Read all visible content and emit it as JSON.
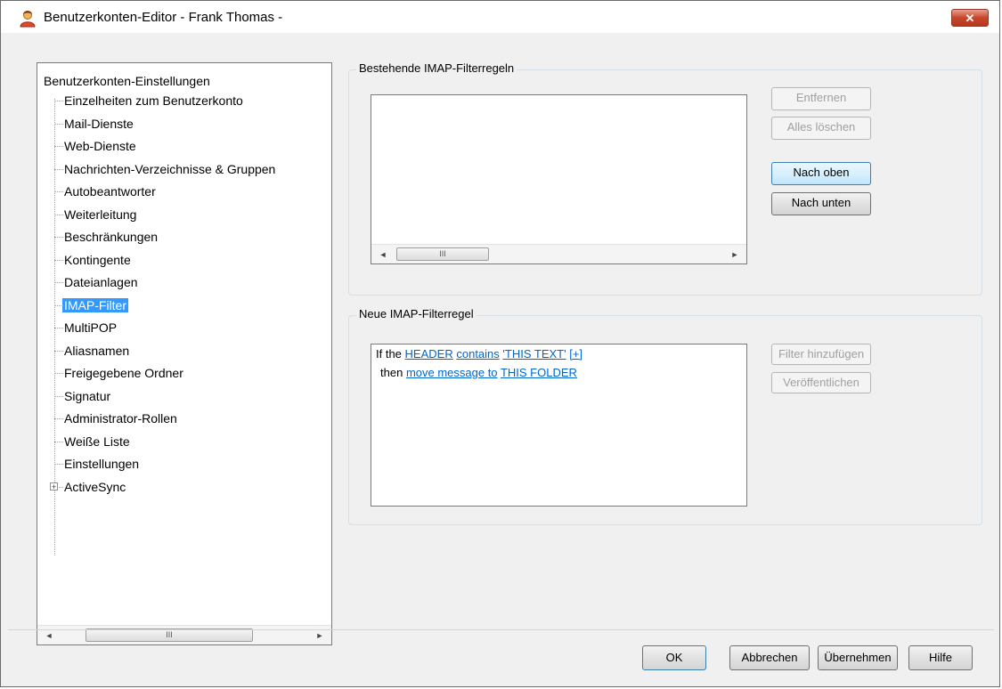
{
  "window": {
    "title": "Benutzerkonten-Editor - Frank Thomas -",
    "close_label": "✕"
  },
  "tree": {
    "root_label": "Benutzerkonten-Einstellungen",
    "items": [
      {
        "label": "Einzelheiten zum Benutzerkonto"
      },
      {
        "label": "Mail-Dienste"
      },
      {
        "label": "Web-Dienste"
      },
      {
        "label": "Nachrichten-Verzeichnisse & Gruppen"
      },
      {
        "label": "Autobeantworter"
      },
      {
        "label": "Weiterleitung"
      },
      {
        "label": "Beschränkungen"
      },
      {
        "label": "Kontingente"
      },
      {
        "label": "Dateianlagen"
      },
      {
        "label": "IMAP-Filter",
        "selected": true
      },
      {
        "label": "MultiPOP"
      },
      {
        "label": "Aliasnamen"
      },
      {
        "label": "Freigegebene Ordner"
      },
      {
        "label": "Signatur"
      },
      {
        "label": "Administrator-Rollen"
      },
      {
        "label": "Weiße Liste"
      },
      {
        "label": "Einstellungen"
      },
      {
        "label": "ActiveSync",
        "expandable": true
      }
    ],
    "scroll_left": "◄",
    "scroll_right": "►",
    "scroll_grip": "III"
  },
  "existing_rules": {
    "group_label": "Bestehende IMAP-Filterregeln",
    "remove_button": "Entfernen",
    "clear_all_button": "Alles löschen",
    "move_up_button": "Nach oben",
    "move_down_button": "Nach unten",
    "scroll_left": "◄",
    "scroll_right": "►",
    "scroll_grip": "III"
  },
  "new_rule": {
    "group_label": "Neue IMAP-Filterregel",
    "line1_prefix": "If the",
    "header_link": "HEADER",
    "contains_link": "contains",
    "text_link": "'THIS TEXT'",
    "plus_link": "[+]",
    "line2_prefix": "then",
    "action_link": "move message to",
    "folder_link": "THIS FOLDER",
    "add_filter_button": "Filter hinzufügen",
    "publish_button": "Veröffentlichen"
  },
  "footer": {
    "ok_button": "OK",
    "cancel_button": "Abbrechen",
    "apply_button": "Übernehmen",
    "help_button": "Hilfe"
  }
}
